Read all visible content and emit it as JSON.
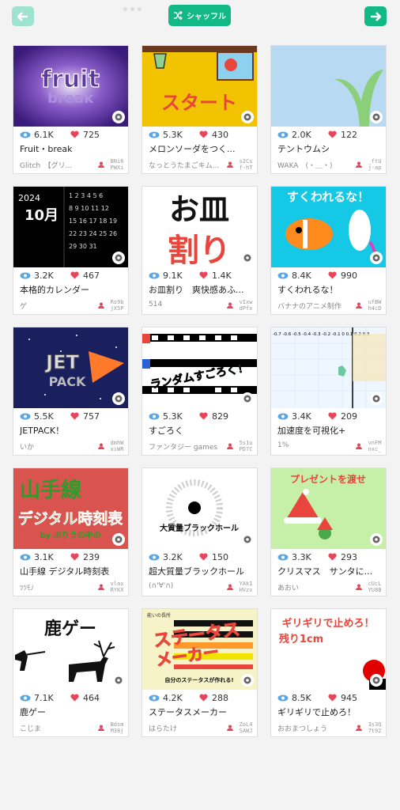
{
  "header": {
    "shuffle_label": "シャッフル",
    "back_icon": "arrow-left-icon",
    "next_icon": "arrow-right-icon"
  },
  "colors": {
    "accent": "#12b886",
    "accent_disabled": "#9fe3cf",
    "like": "#e8445a",
    "view": "#5ba7e6"
  },
  "cards": [
    {
      "views": "6.1K",
      "likes": "725",
      "title": "Fruit・break",
      "author": "Glitch　【グリ...",
      "uid1": "BNi6",
      "uid2": "PWXi",
      "thumb_text": "fruit"
    },
    {
      "views": "5.3K",
      "likes": "430",
      "title": "メロンソーダをつく...",
      "author": "なっとうたまごキム...",
      "uid1": "s2Cs",
      "uid2": "f-hT",
      "thumb_text": "スタート"
    },
    {
      "views": "2.0K",
      "likes": "122",
      "title": "テントウムシ",
      "author": "WAKA　(・＿・)",
      "uid1": "_ftU",
      "uid2": "j-ap",
      "thumb_text": ""
    },
    {
      "views": "3.2K",
      "likes": "467",
      "title": "本格的カレンダー",
      "author": "ゲ",
      "uid1": "Rs9b",
      "uid2": "jX5P",
      "thumb_text": "2024"
    },
    {
      "views": "9.1K",
      "likes": "1.4K",
      "title": "お皿割り　爽快感あふ...",
      "author": "514",
      "uid1": "vIxw",
      "uid2": "dPfx",
      "thumb_text": "お皿"
    },
    {
      "views": "8.4K",
      "likes": "990",
      "title": "すくわれるな！",
      "author": "バナナのアニメ制作",
      "uid1": "ufBW",
      "uid2": "h4cD",
      "thumb_text": "すくわれるな！"
    },
    {
      "views": "5.5K",
      "likes": "757",
      "title": "JETPACK！",
      "author": "いか",
      "uid1": "dmhW",
      "uid2": "xiWR",
      "thumb_text": "JET"
    },
    {
      "views": "5.3K",
      "likes": "829",
      "title": "すごろく",
      "author": "ファンタジー games",
      "uid1": "5s1u",
      "uid2": "PD7C",
      "thumb_text": "ランダムすごろく！"
    },
    {
      "views": "3.4K",
      "likes": "209",
      "title": "加速度を可視化+",
      "author": "1%",
      "uid1": "vnFM",
      "uid2": "nxc_",
      "thumb_text": "-0.7 -0.6 -0.5 -0.4 -0.3 -0.2 -0.1 0 0.1 0.2 0.3"
    },
    {
      "views": "3.1K",
      "likes": "239",
      "title": "山手線 デジタル時刻表",
      "author": "ﾂﾂﾓﾉ",
      "uid1": "vlax",
      "uid2": "RYKX",
      "thumb_text": "山手線"
    },
    {
      "views": "3.2K",
      "likes": "150",
      "title": "超大質量ブラックホール",
      "author": "(∩'∀'∩)",
      "uid1": "YAk1",
      "uid2": "HVzx",
      "thumb_text": "大質量ブラックホール"
    },
    {
      "views": "3.3K",
      "likes": "293",
      "title": "クリスマス　サンタに...",
      "author": "あおい",
      "uid1": "cUcL",
      "uid2": "YU8B",
      "thumb_text": "プレゼントを渡せ"
    },
    {
      "views": "7.1K",
      "likes": "464",
      "title": "鹿ゲー",
      "author": "こじま",
      "uid1": "Bdsm",
      "uid2": "M38j",
      "thumb_text": "鹿ゲー"
    },
    {
      "views": "4.2K",
      "likes": "288",
      "title": "ステータスメーカー",
      "author": "はらたけ",
      "uid1": "ZoL4",
      "uid2": "SAWJ",
      "thumb_text": "ステータス"
    },
    {
      "views": "8.5K",
      "likes": "945",
      "title": "ギリギリで止めろ！",
      "author": "おおまつしょう",
      "uid1": "3s3Q",
      "uid2": "7t92",
      "thumb_text": "ギリギリで止めろ！"
    }
  ],
  "thumb_extra": {
    "fruit_sub": "break",
    "cal_month": "10月",
    "sara_bottom": "割り",
    "jet_sub": "PACK",
    "yamanote_sub": "デジタル時刻表",
    "yamanote_by": "by ぷりうの中の",
    "shika_lines": "",
    "status_top": "ステータス",
    "status_bottom": "メーカー",
    "status_hint": "自分のステータスが作れる!",
    "status_small": "能いの長所",
    "girigiri_sub": "残り1cm"
  }
}
